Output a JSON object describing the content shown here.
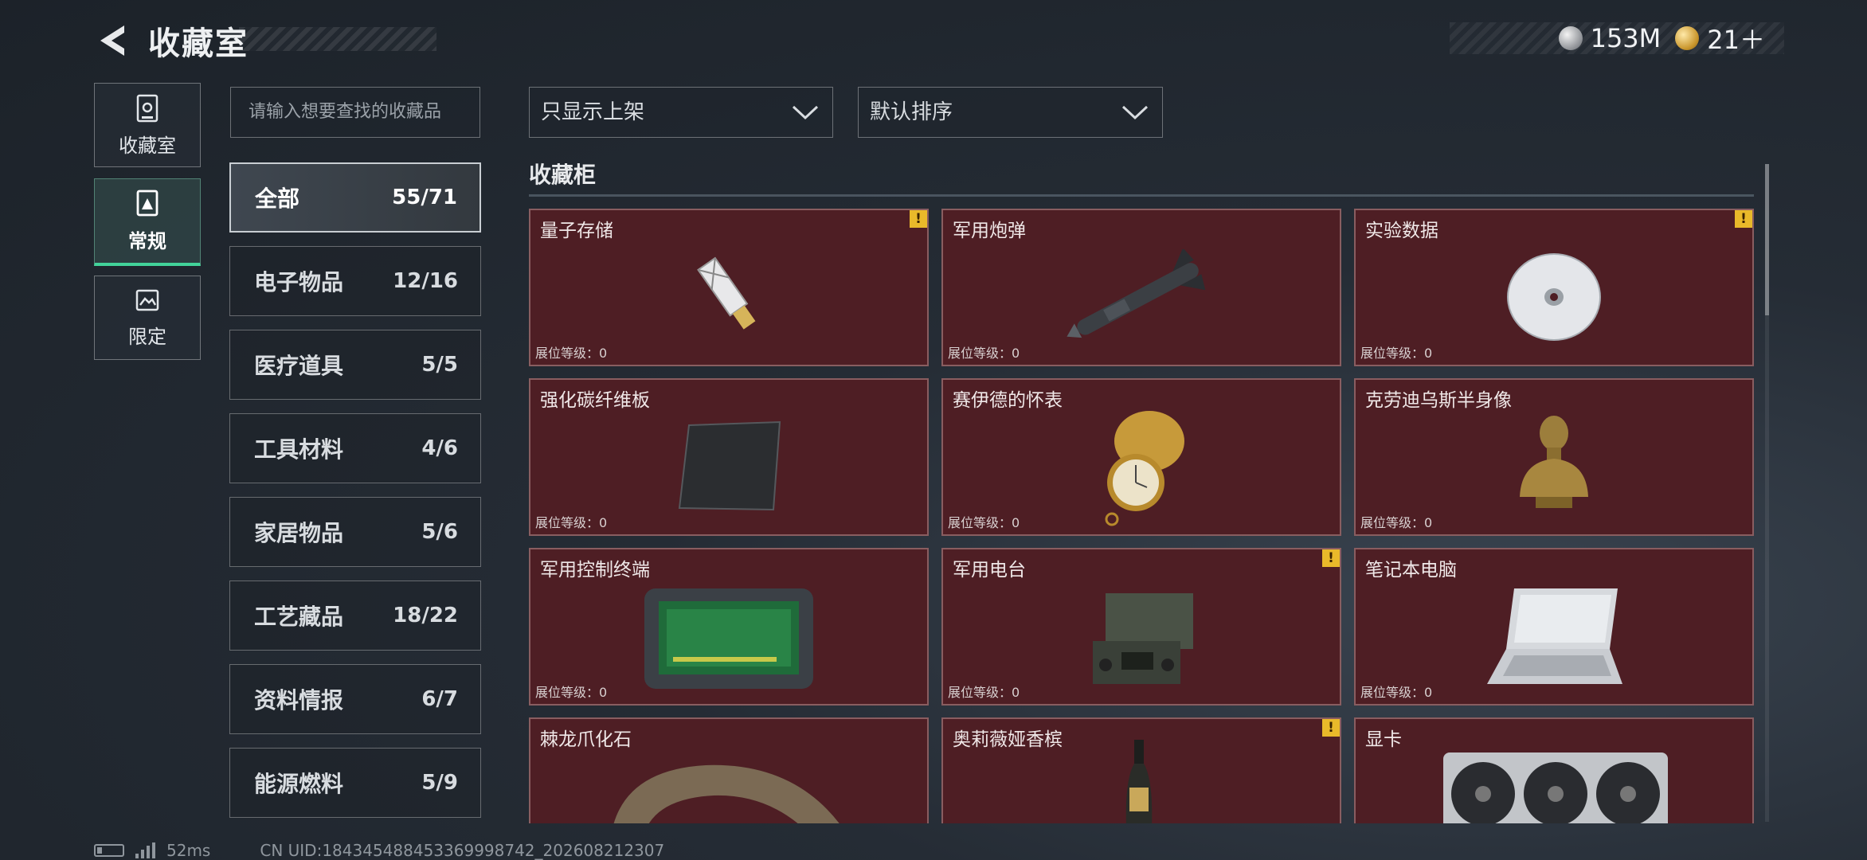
{
  "header": {
    "title": "收藏室",
    "currency": [
      {
        "icon": "silver-coin-icon",
        "value": "153M"
      },
      {
        "icon": "gold-coin-icon",
        "value": "21＋"
      }
    ]
  },
  "nav": [
    {
      "label": "收藏室",
      "icon": "collection-room-icon",
      "active": false
    },
    {
      "label": "常规",
      "icon": "regular-icon",
      "active": true
    },
    {
      "label": "限定",
      "icon": "limited-icon",
      "active": false
    }
  ],
  "search": {
    "placeholder": "请输入想要查找的收藏品"
  },
  "filters": {
    "display": "只显示上架",
    "sort": "默认排序"
  },
  "categories": [
    {
      "name": "全部",
      "count": "55/71",
      "active": true
    },
    {
      "name": "电子物品",
      "count": "12/16"
    },
    {
      "name": "医疗道具",
      "count": "5/5"
    },
    {
      "name": "工具材料",
      "count": "4/6"
    },
    {
      "name": "家居物品",
      "count": "5/6"
    },
    {
      "name": "工艺藏品",
      "count": "18/22"
    },
    {
      "name": "资料情报",
      "count": "6/7"
    },
    {
      "name": "能源燃料",
      "count": "5/9"
    }
  ],
  "section": {
    "title": "收藏柜"
  },
  "items": [
    {
      "name": "量子存储",
      "level": "展位等级：0",
      "alert": true,
      "icon": "usb-drive-icon"
    },
    {
      "name": "军用炮弹",
      "level": "展位等级：0",
      "alert": false,
      "icon": "missile-icon"
    },
    {
      "name": "实验数据",
      "level": "展位等级：0",
      "alert": true,
      "icon": "disc-icon"
    },
    {
      "name": "强化碳纤维板",
      "level": "展位等级：0",
      "alert": false,
      "icon": "carbon-plate-icon"
    },
    {
      "name": "赛伊德的怀表",
      "level": "展位等级：0",
      "alert": false,
      "icon": "pocket-watch-icon"
    },
    {
      "name": "克劳迪乌斯半身像",
      "level": "展位等级：0",
      "alert": false,
      "icon": "bust-icon"
    },
    {
      "name": "军用控制终端",
      "level": "展位等级：0",
      "alert": false,
      "icon": "control-terminal-icon"
    },
    {
      "name": "军用电台",
      "level": "展位等级：0",
      "alert": true,
      "icon": "radio-icon"
    },
    {
      "name": "笔记本电脑",
      "level": "展位等级：0",
      "alert": false,
      "icon": "laptop-icon"
    },
    {
      "name": "棘龙爪化石",
      "level": "",
      "alert": false,
      "icon": "claw-fossil-icon"
    },
    {
      "name": "奥莉薇娅香槟",
      "level": "",
      "alert": true,
      "icon": "champagne-icon"
    },
    {
      "name": "显卡",
      "level": "",
      "alert": false,
      "icon": "graphics-card-icon"
    }
  ],
  "alert_symbol": "!",
  "footer": {
    "ping": "52ms",
    "uid": "CN UID:184345488453369998742_202608212307"
  }
}
